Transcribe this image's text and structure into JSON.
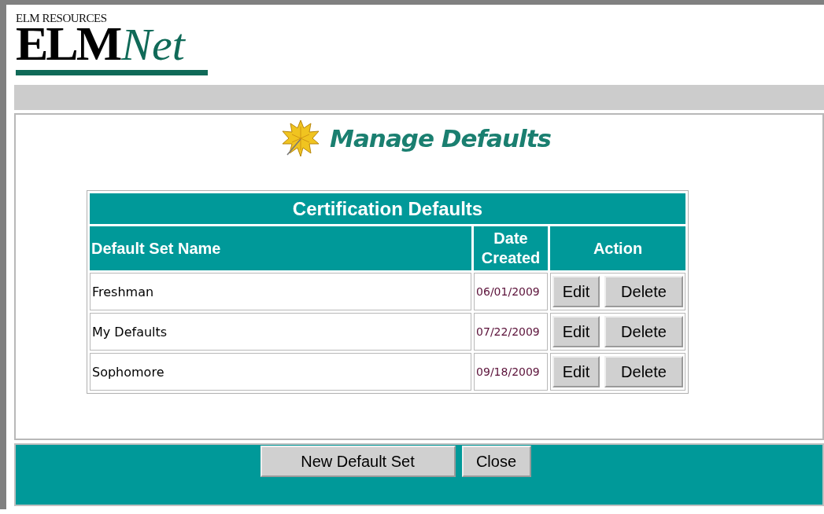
{
  "logo": {
    "top": "ELM RESOURCES",
    "main": "ELM",
    "accent": "Net"
  },
  "page_title": "Manage Defaults",
  "table": {
    "title": "Certification Defaults",
    "columns": [
      "Default Set Name",
      "Date Created",
      "Action"
    ],
    "rows": [
      {
        "name": "Freshman",
        "date": "06/01/2009",
        "actions": [
          "Edit",
          "Delete"
        ]
      },
      {
        "name": "My Defaults",
        "date": "07/22/2009",
        "actions": [
          "Edit",
          "Delete"
        ]
      },
      {
        "name": "Sophomore",
        "date": "09/18/2009",
        "actions": [
          "Edit",
          "Delete"
        ]
      }
    ]
  },
  "buttons": [
    "New Default Set",
    "Close"
  ]
}
